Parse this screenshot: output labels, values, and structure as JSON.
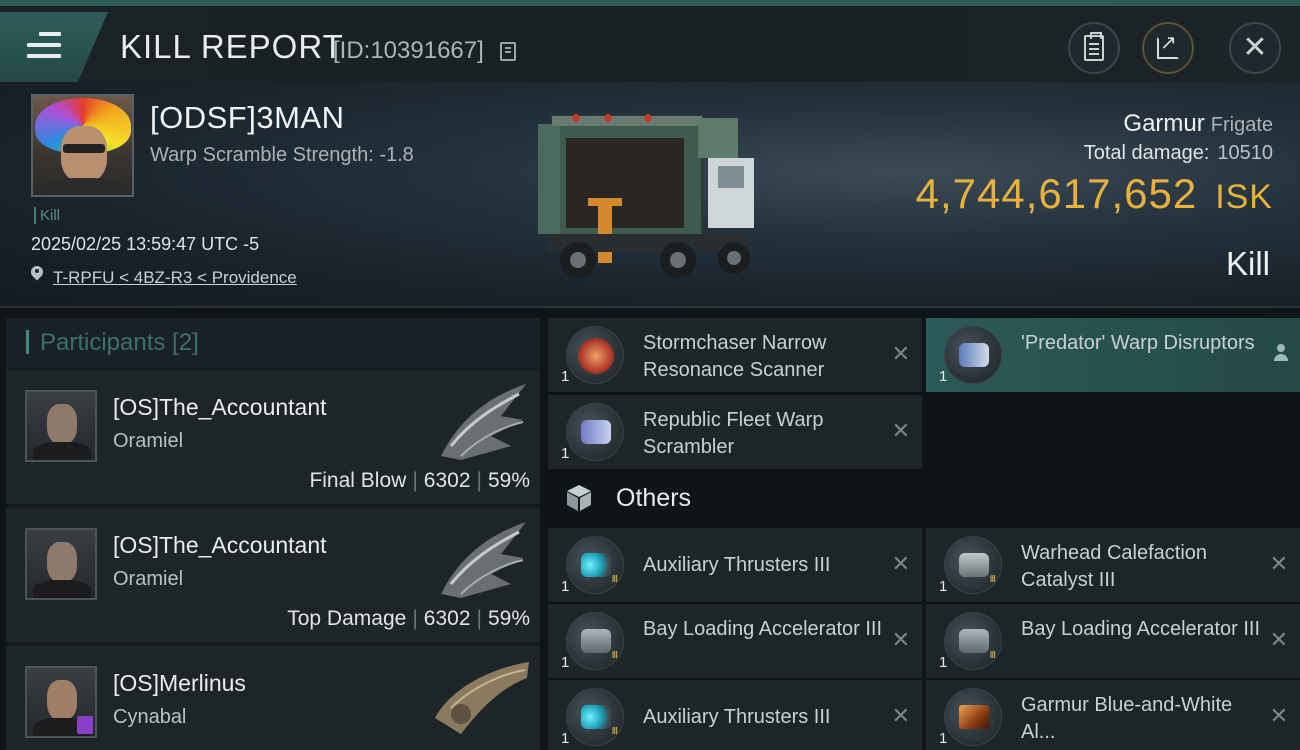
{
  "header": {
    "title": "KILL REPORT",
    "report_id": "[ID:10391667]"
  },
  "victim": {
    "name": "[ODSF]3MAN",
    "warp_scramble": "Warp Scramble Strength: -1.8",
    "kill_tag": "Kill",
    "datetime": "2025/02/25 13:59:47 UTC -5",
    "location": "T-RPFU < 4BZ-R3 < Providence",
    "ship": "Garmur",
    "ship_class": "Frigate",
    "total_damage_label": "Total damage:",
    "total_damage": "10510",
    "isk_value": "4,744,617,652",
    "isk_unit": "ISK",
    "result": "Kill"
  },
  "participants": {
    "header": "Participants [2]",
    "rows": [
      {
        "name": "[OS]The_Accountant",
        "ship": "Oramiel",
        "role": "Final Blow",
        "damage": "6302",
        "percent": "59%"
      },
      {
        "name": "[OS]The_Accountant",
        "ship": "Oramiel",
        "role": "Top Damage",
        "damage": "6302",
        "percent": "59%"
      },
      {
        "name": "[OS]Merlinus",
        "ship": "Cynabal"
      }
    ]
  },
  "modules": {
    "fitted": [
      {
        "name": "Stormchaser Narrow Resonance Scanner",
        "qty": "1"
      },
      {
        "name": "'Predator' Warp Disruptors",
        "qty": "1"
      },
      {
        "name": "Republic Fleet Warp Scrambler",
        "qty": "1"
      }
    ],
    "others_label": "Others",
    "others": [
      {
        "name": "Auxiliary Thrusters III",
        "qty": "1"
      },
      {
        "name": "Warhead Calefaction Catalyst III",
        "qty": "1"
      },
      {
        "name": "Bay Loading Accelerator III",
        "qty": "1"
      },
      {
        "name": "Bay Loading Accelerator III",
        "qty": "1"
      },
      {
        "name": "Auxiliary Thrusters III",
        "qty": "1"
      },
      {
        "name": "Garmur Blue-and-White Al...",
        "qty": "1"
      }
    ]
  },
  "icons": {
    "menu": "menu-icon",
    "copy": "copy-icon",
    "clipboard": "clipboard-icon",
    "share": "share-icon",
    "close": "close-icon",
    "location": "location-pin-icon",
    "remove": "x-icon",
    "owner": "person-icon",
    "others": "cube-icon"
  },
  "colors": {
    "accent": "#2c5a58",
    "isk": "#e7b13e",
    "panel": "#1d2529"
  }
}
